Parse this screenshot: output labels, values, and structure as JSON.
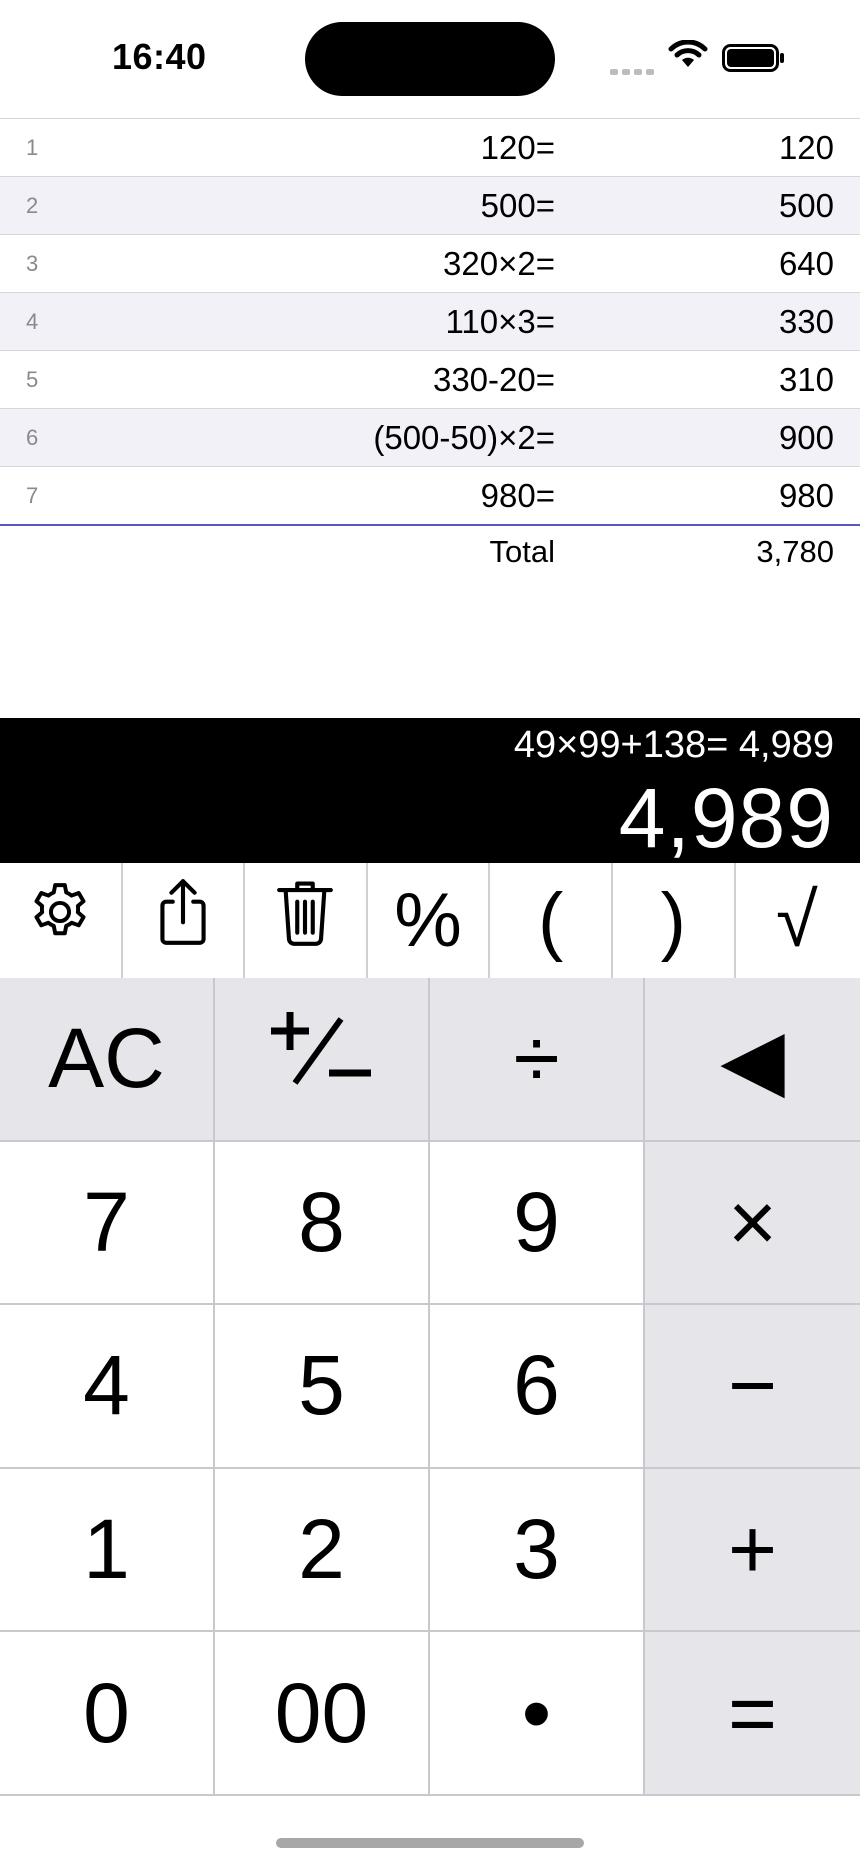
{
  "status_bar": {
    "time": "16:40"
  },
  "tape": {
    "rows": [
      {
        "index": "1",
        "expression": "120=",
        "result": "120"
      },
      {
        "index": "2",
        "expression": "500=",
        "result": "500"
      },
      {
        "index": "3",
        "expression": "320×2=",
        "result": "640"
      },
      {
        "index": "4",
        "expression": "110×3=",
        "result": "330"
      },
      {
        "index": "5",
        "expression": "330-20=",
        "result": "310"
      },
      {
        "index": "6",
        "expression": "(500-50)×2=",
        "result": "900"
      },
      {
        "index": "7",
        "expression": "980=",
        "result": "980"
      }
    ],
    "total_label": "Total",
    "total_value": "3,780"
  },
  "display": {
    "formula": "49×99+138= 4,989",
    "result": "4,989"
  },
  "toolbar": {
    "settings_icon": "gear-icon",
    "share_icon": "share-icon",
    "trash_icon": "trash-icon",
    "percent": "%",
    "open_paren": "(",
    "close_paren": ")",
    "sqrt": "√"
  },
  "keypad": {
    "ac": "AC",
    "divide": "÷",
    "backspace": "◀",
    "seven": "7",
    "eight": "8",
    "nine": "9",
    "multiply": "×",
    "four": "4",
    "five": "5",
    "six": "6",
    "minus": "−",
    "one": "1",
    "two": "2",
    "three": "3",
    "plus": "+",
    "zero": "0",
    "double_zero": "00",
    "decimal": "•",
    "equals": "="
  },
  "colors": {
    "accent_line": "#5a56c6",
    "key_gray": "#e5e5ea",
    "row_alt": "#f1f1f7"
  }
}
